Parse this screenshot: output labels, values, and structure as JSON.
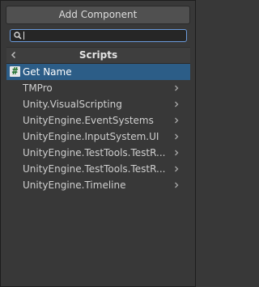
{
  "header": {
    "title": "Add Component"
  },
  "search": {
    "value": "",
    "placeholder": ""
  },
  "breadcrumb": {
    "title": "Scripts"
  },
  "items": [
    {
      "label": "Get Name",
      "icon": "csharp-script-icon",
      "selected": true,
      "has_children": false
    },
    {
      "label": "TMPro",
      "selected": false,
      "has_children": true
    },
    {
      "label": "Unity.VisualScripting",
      "selected": false,
      "has_children": true
    },
    {
      "label": "UnityEngine.EventSystems",
      "selected": false,
      "has_children": true
    },
    {
      "label": "UnityEngine.InputSystem.UI",
      "selected": false,
      "has_children": true
    },
    {
      "label": "UnityEngine.TestTools.TestR...",
      "selected": false,
      "has_children": true
    },
    {
      "label": "UnityEngine.TestTools.TestR...",
      "selected": false,
      "has_children": true
    },
    {
      "label": "UnityEngine.Timeline",
      "selected": false,
      "has_children": true
    }
  ],
  "colors": {
    "panel_bg": "#383838",
    "selection": "#2c5d87",
    "focus_border": "#6b9bdc",
    "text": "#cfcfcf"
  }
}
